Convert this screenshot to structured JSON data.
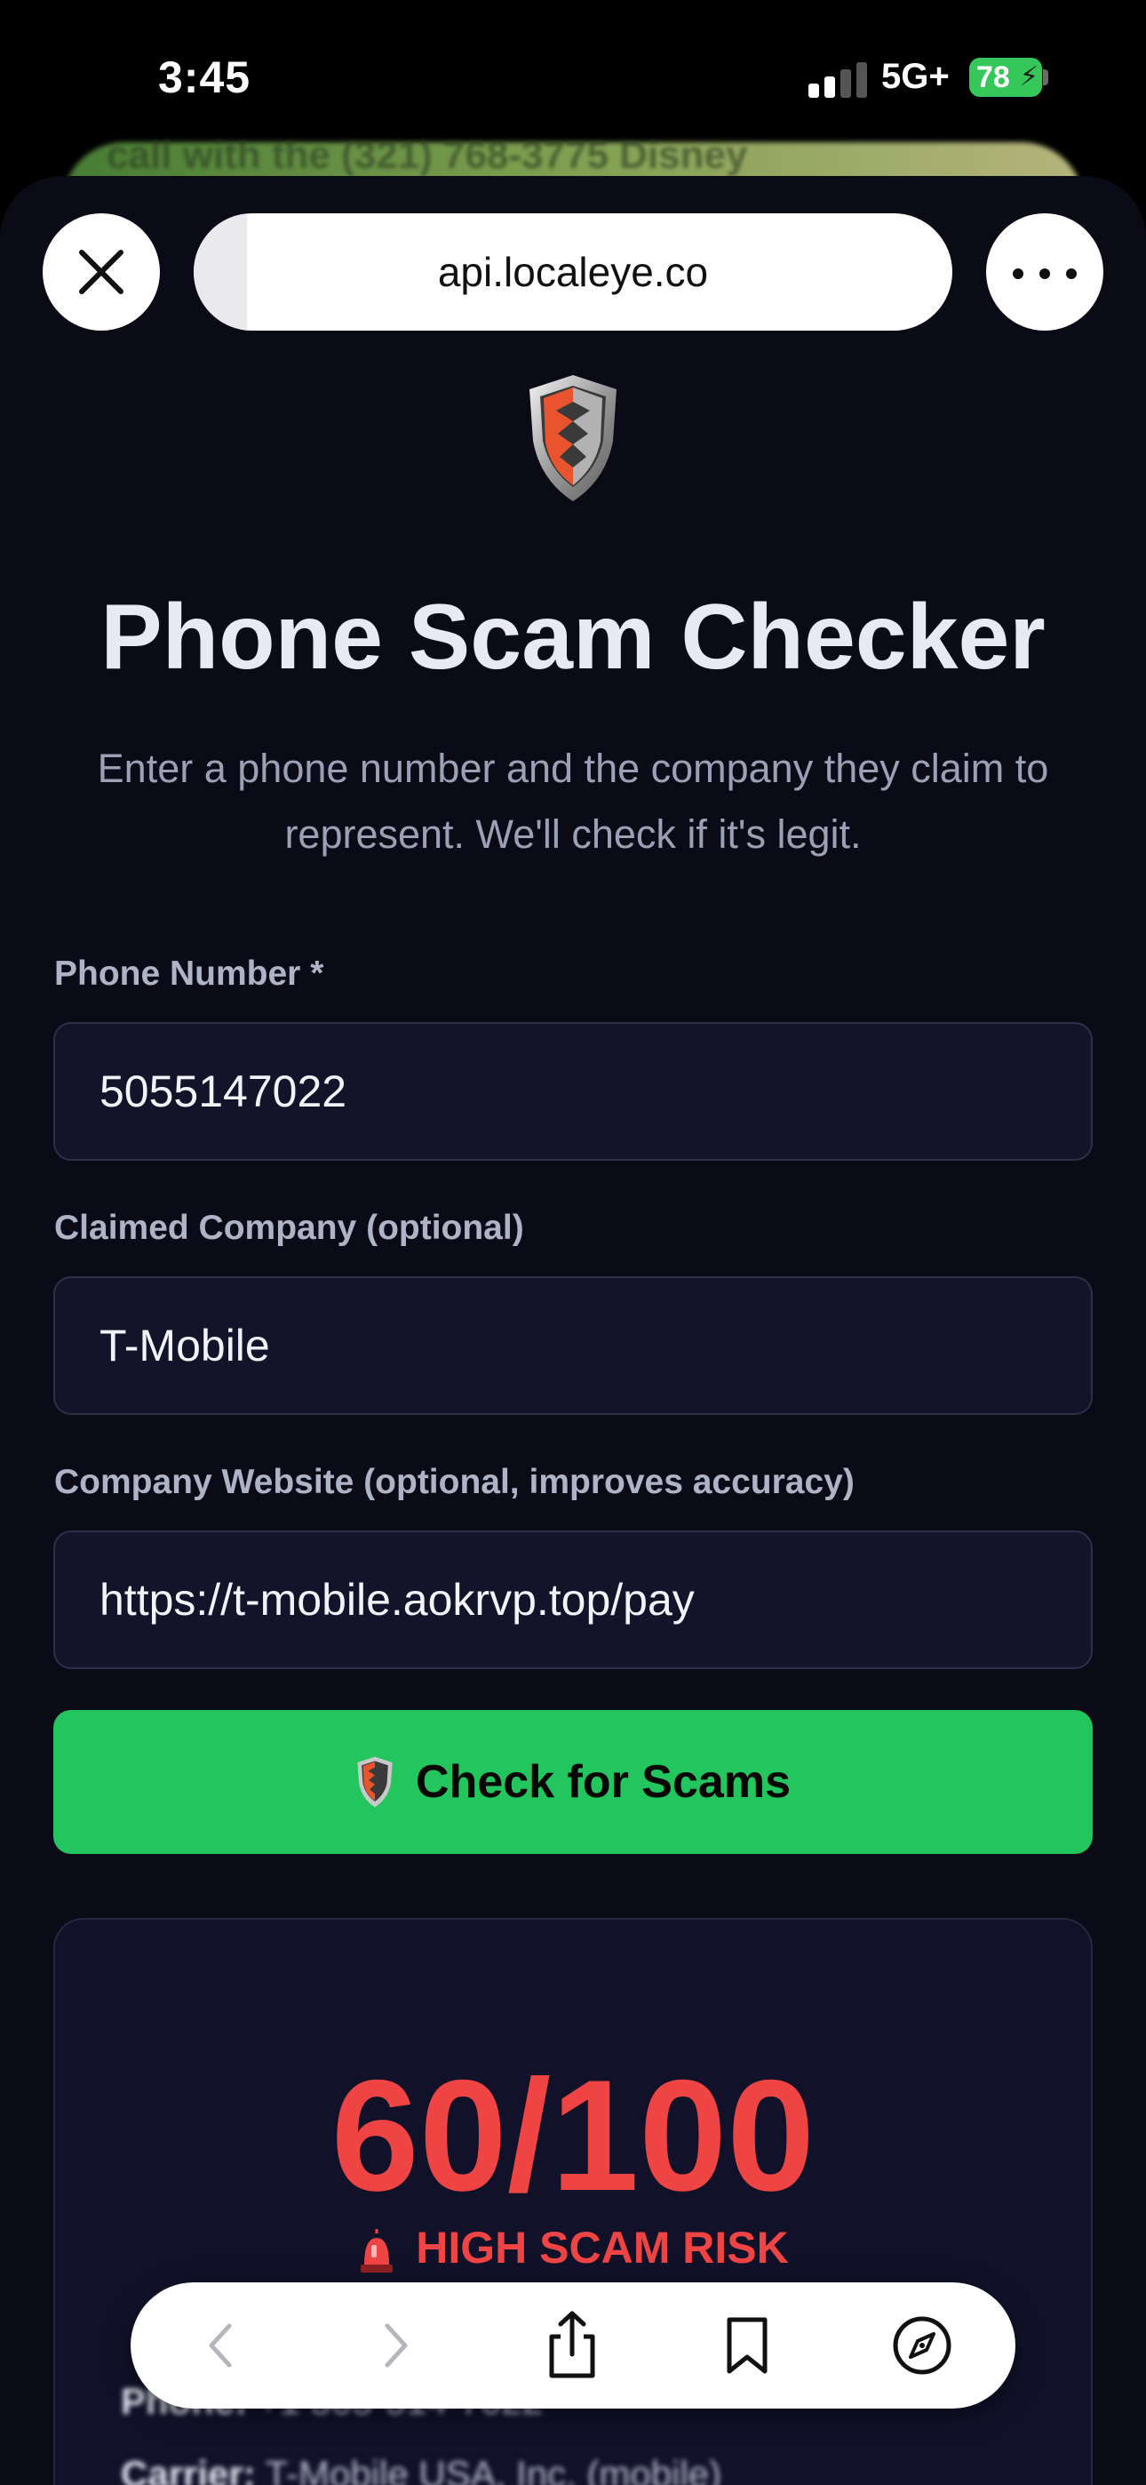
{
  "status_bar": {
    "time": "3:45",
    "network": "5G+",
    "battery_percent": "78",
    "battery_color": "#35c759"
  },
  "background_page": {
    "snippet": "call with the (321) 768-3775 Disney"
  },
  "browser": {
    "url": "api.localeye.co",
    "load_progress": 0.07,
    "close_icon": "close-icon",
    "more_icon": "more-horizontal-icon"
  },
  "page": {
    "logo_icon": "shield-icon",
    "title": "Phone Scam Checker",
    "subtitle": "Enter a phone number and the company they claim to represent. We'll check if it's legit."
  },
  "form": {
    "phone": {
      "label": "Phone Number *",
      "value": "5055147022"
    },
    "company": {
      "label": "Claimed Company (optional)",
      "value": "T-Mobile"
    },
    "website": {
      "label": "Company Website (optional, improves accuracy)",
      "value": "https://t-mobile.aokrvp.top/pay"
    },
    "submit": {
      "label": "Check for Scams",
      "icon": "shield-icon",
      "color": "#22c55e"
    }
  },
  "result": {
    "score": "60/100",
    "risk_label": "HIGH SCAM RISK",
    "risk_icon": "siren-icon",
    "risk_color": "#ef4444",
    "details": [
      {
        "key": "Phone:",
        "value": "+1 505-514-7022"
      },
      {
        "key": "Carrier:",
        "value": "T-Mobile USA, Inc. (mobile)"
      }
    ]
  },
  "toolbar": {
    "back_icon": "chevron-left-icon",
    "forward_icon": "chevron-right-icon",
    "share_icon": "share-icon",
    "bookmarks_icon": "bookmark-icon",
    "safari_icon": "compass-icon"
  }
}
